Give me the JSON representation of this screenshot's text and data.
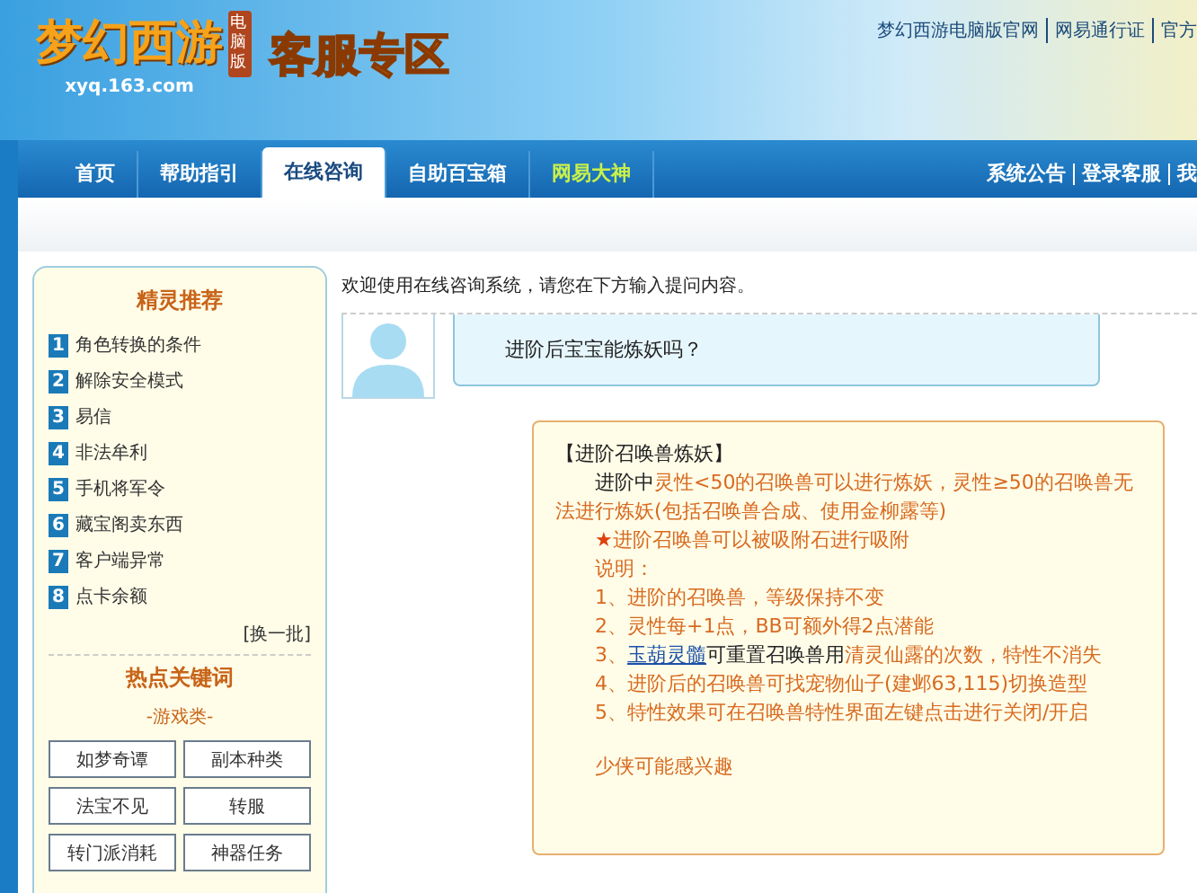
{
  "header": {
    "logo_text": "梦幻西游",
    "logo_badge": "电脑版",
    "logo_url": "xyq.163.com",
    "title": "客服专区",
    "top_links": [
      "梦幻西游电脑版官网",
      "网易通行证",
      "官方"
    ]
  },
  "nav": {
    "tabs": [
      {
        "label": "首页",
        "selected": false,
        "highlight": false
      },
      {
        "label": "帮助指引",
        "selected": false,
        "highlight": false
      },
      {
        "label": "在线咨询",
        "selected": true,
        "highlight": false
      },
      {
        "label": "自助百宝箱",
        "selected": false,
        "highlight": false
      },
      {
        "label": "网易大神",
        "selected": false,
        "highlight": true
      }
    ],
    "right_links": [
      "系统公告",
      "登录客服",
      "我"
    ]
  },
  "sidebar": {
    "title": "精灵推荐",
    "items": [
      {
        "num": "1",
        "label": "角色转换的条件"
      },
      {
        "num": "2",
        "label": "解除安全模式"
      },
      {
        "num": "3",
        "label": "易信"
      },
      {
        "num": "4",
        "label": "非法牟利"
      },
      {
        "num": "5",
        "label": "手机将军令"
      },
      {
        "num": "6",
        "label": "藏宝阁卖东西"
      },
      {
        "num": "7",
        "label": "客户端异常"
      },
      {
        "num": "8",
        "label": "点卡余额"
      }
    ],
    "refresh": "[换一批]",
    "hot_title": "热点关键词",
    "category": "-游戏类-",
    "keywords": [
      "如梦奇谭",
      "副本种类",
      "法宝不见",
      "转服",
      "转门派消耗",
      "神器任务"
    ]
  },
  "chat": {
    "welcome": "欢迎使用在线咨询系统，请您在下方输入提问内容。",
    "question": "进阶后宝宝能炼妖吗？",
    "answer": [
      {
        "indent": false,
        "segments": [
          {
            "kind": "plain",
            "text": "【进阶召唤兽炼妖】"
          }
        ]
      },
      {
        "indent": true,
        "segments": [
          {
            "kind": "plain",
            "text": "进阶中"
          },
          {
            "kind": "orange",
            "text": "灵性<50的召唤兽可以进行炼妖，灵性≥50的召唤兽无法进行炼妖(包括召唤兽合成、使用金柳露等)"
          }
        ]
      },
      {
        "indent": true,
        "segments": [
          {
            "kind": "star",
            "text": "★"
          },
          {
            "kind": "orange",
            "text": "进阶召唤兽可以被吸附石进行吸附"
          }
        ]
      },
      {
        "indent": true,
        "segments": [
          {
            "kind": "orange",
            "text": "说明："
          }
        ]
      },
      {
        "indent": true,
        "segments": [
          {
            "kind": "orange",
            "text": "1、进阶的召唤兽，等级保持不变"
          }
        ]
      },
      {
        "indent": true,
        "segments": [
          {
            "kind": "orange",
            "text": "2、灵性每+1点，BB可额外得2点潜能"
          }
        ]
      },
      {
        "indent": true,
        "segments": [
          {
            "kind": "orange",
            "text": "3、"
          },
          {
            "kind": "link",
            "text": "玉葫灵髓"
          },
          {
            "kind": "plain",
            "text": "可重置召唤兽用"
          },
          {
            "kind": "orange",
            "text": "清灵仙露的次数，特性不消失"
          }
        ]
      },
      {
        "indent": true,
        "segments": [
          {
            "kind": "orange",
            "text": "4、进阶后的召唤兽可找宠物仙子(建邺63,115)切换造型"
          }
        ]
      },
      {
        "indent": true,
        "segments": [
          {
            "kind": "orange",
            "text": "5、特性效果可在召唤兽特性界面左键点击进行关闭/开启"
          }
        ]
      }
    ],
    "more": "少侠可能感兴趣"
  }
}
